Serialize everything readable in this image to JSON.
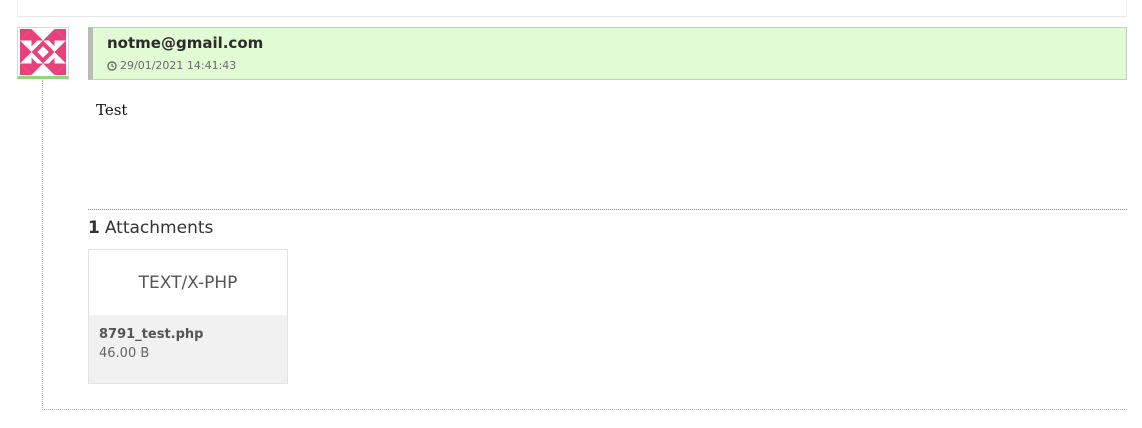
{
  "message": {
    "sender": "notme@gmail.com",
    "timestamp": "29/01/2021 14:41:43",
    "timestamp_icon": "clock-icon",
    "avatar": {
      "icon": "identicon-avatar",
      "color": "#e8407a"
    },
    "body": "Test"
  },
  "attachments": {
    "count": "1",
    "label": "Attachments",
    "items": [
      {
        "type": "TEXT/X-PHP",
        "name": "8791_test.php",
        "size": "46.00 B"
      }
    ]
  },
  "colors": {
    "header_bg": "#e1fbd4",
    "avatar_accent": "#8fd87a"
  }
}
